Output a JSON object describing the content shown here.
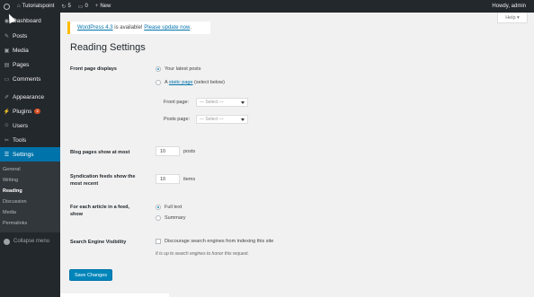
{
  "adminbar": {
    "site_name": "Tutorialspoint",
    "updates_count": "5",
    "comments_count": "0",
    "new_label": "New",
    "howdy": "Howdy, admin"
  },
  "sidebar": {
    "items": [
      {
        "label": "Dashboard",
        "icon": "dashboard-icon"
      },
      {
        "label": "Posts",
        "icon": "pin-icon"
      },
      {
        "label": "Media",
        "icon": "media-icon"
      },
      {
        "label": "Pages",
        "icon": "pages-icon"
      },
      {
        "label": "Comments",
        "icon": "comment-icon"
      },
      {
        "label": "Appearance",
        "icon": "brush-icon"
      },
      {
        "label": "Plugins",
        "icon": "plugin-icon",
        "badge": "2"
      },
      {
        "label": "Users",
        "icon": "users-icon"
      },
      {
        "label": "Tools",
        "icon": "wrench-icon"
      },
      {
        "label": "Settings",
        "icon": "settings-icon"
      }
    ],
    "submenu": [
      "General",
      "Writing",
      "Reading",
      "Discussion",
      "Media",
      "Permalinks"
    ],
    "collapse_label": "Collapse menu"
  },
  "help_label": "Help",
  "notice": {
    "link_text": "WordPress 4.3",
    "middle": " is available! ",
    "update_link": "Please update now",
    "end": "."
  },
  "page_title": "Reading Settings",
  "front_page": {
    "label": "Front page displays",
    "option_latest": "Your latest posts",
    "option_static_prefix": "A ",
    "option_static_link": "static page",
    "option_static_suffix": " (select below)",
    "front_page_label": "Front page:",
    "posts_page_label": "Posts page:",
    "select_placeholder": "— Select —"
  },
  "blog_pages": {
    "label": "Blog pages show at most",
    "value": "10",
    "unit": "posts"
  },
  "syndication": {
    "label_line1": "Syndication feeds show the",
    "label_line2": "most recent",
    "value": "10",
    "unit": "items"
  },
  "feed_article": {
    "label_line1": "For each article in a feed,",
    "label_line2": "show",
    "option_full": "Full text",
    "option_summary": "Summary"
  },
  "search_engine": {
    "label": "Search Engine Visibility",
    "checkbox_label": "Discourage search engines from indexing this site",
    "description": "It is up to search engines to honor this request."
  },
  "save_label": "Save Changes",
  "colors": {
    "accent": "#0073aa",
    "sidebar_bg": "#23282d",
    "notice_border": "#ffba00"
  }
}
